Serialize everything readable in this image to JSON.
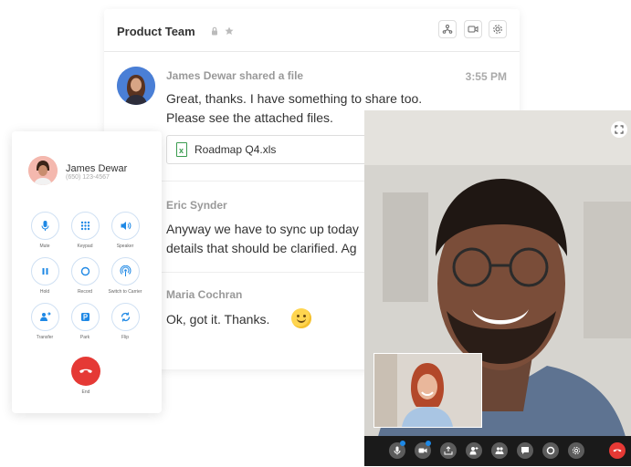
{
  "chat": {
    "title": "Product Team",
    "messages": [
      {
        "author": "James Dewar shared a file",
        "time": "3:55 PM",
        "text": "Great, thanks. I have something to share too.\nPlease see the attached files.",
        "file": "Roadmap Q4.xls",
        "file_icon_letter": "x"
      },
      {
        "author": "Eric Synder",
        "text": "Anyway we have to sync up today\ndetails that should be clarified. Ag"
      },
      {
        "author": "Maria Cochran",
        "text": "Ok, got it. Thanks."
      }
    ],
    "header_icons": [
      "lock-icon",
      "star-icon",
      "org-chart-icon",
      "video-icon",
      "gear-icon"
    ]
  },
  "dialer": {
    "contact_name": "James Dewar",
    "contact_number": "(650) 123-4567",
    "buttons": [
      {
        "label": "Mute",
        "icon": "microphone-icon"
      },
      {
        "label": "Keypad",
        "icon": "keypad-icon"
      },
      {
        "label": "Speaker",
        "icon": "speaker-icon"
      },
      {
        "label": "Hold",
        "icon": "pause-icon"
      },
      {
        "label": "Record",
        "icon": "record-icon"
      },
      {
        "label": "Switch to Carrier",
        "icon": "carrier-icon"
      },
      {
        "label": "Transfer",
        "icon": "transfer-icon"
      },
      {
        "label": "Park",
        "icon": "park-icon"
      },
      {
        "label": "Flip",
        "icon": "flip-icon"
      }
    ],
    "end_label": "End"
  },
  "video": {
    "controls": [
      "microphone-icon",
      "camera-icon",
      "share-screen-icon",
      "add-participant-icon",
      "participants-icon",
      "chat-icon",
      "record-icon",
      "settings-icon",
      "hang-up-icon"
    ]
  },
  "colors": {
    "accent_blue": "#1e88e5",
    "end_red": "#e53935",
    "excel_green": "#3a9b4f",
    "video_bar": "#1a1a1a"
  }
}
